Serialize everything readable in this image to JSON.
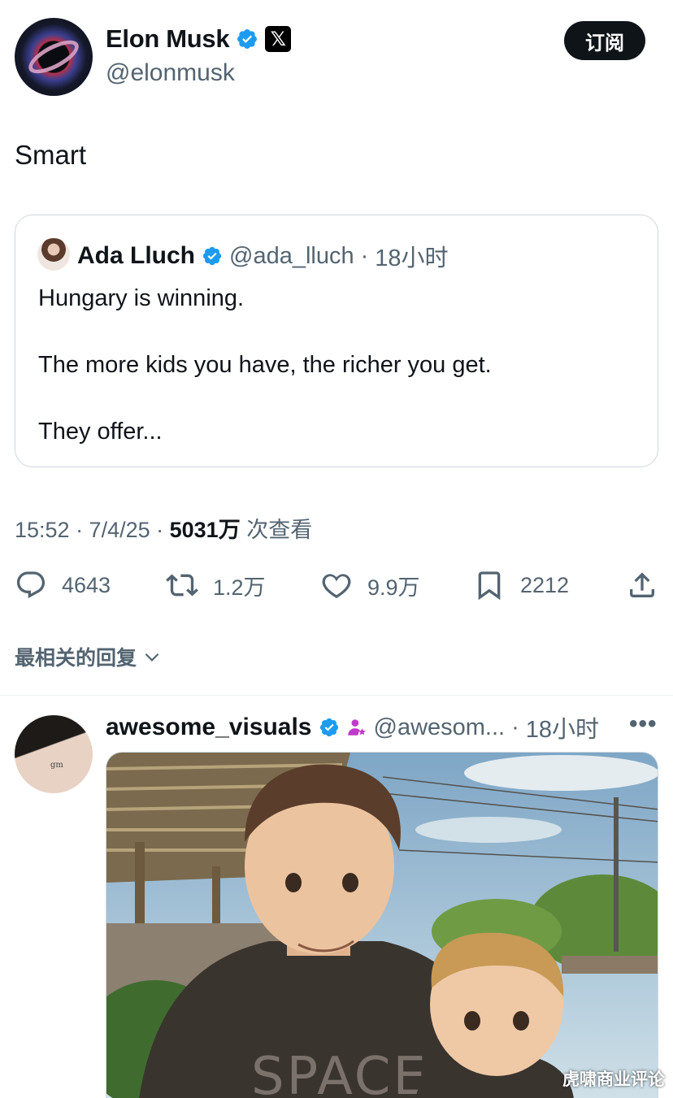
{
  "tweet": {
    "author_name": "Elon Musk",
    "author_handle": "@elonmusk",
    "subscribe_label": "订阅",
    "text": "Smart",
    "x_badge": "𝕏",
    "verified_color": "#1d9bf0"
  },
  "quote": {
    "author_name": "Ada Lluch",
    "author_handle": "@ada_lluch",
    "time": "18小时",
    "lines": [
      "Hungary is winning.",
      "The more kids you have, the richer you get.",
      "They offer..."
    ]
  },
  "meta": {
    "time_date": "15:52 · 7/4/25 · ",
    "views_count": "5031万",
    "views_label": " 次查看"
  },
  "actions": {
    "replies": "4643",
    "reposts": "1.2万",
    "likes": "9.9万",
    "bookmarks": "2212"
  },
  "replies_section": {
    "sort_label": "最相关的回复"
  },
  "reply": {
    "author_name": "awesome_visuals",
    "author_handle": "@awesom...",
    "time": "18小时",
    "more": "•••",
    "avatar_tattoo": "gm",
    "image_text": "SPACE"
  },
  "watermark": "虎啸商业评论"
}
